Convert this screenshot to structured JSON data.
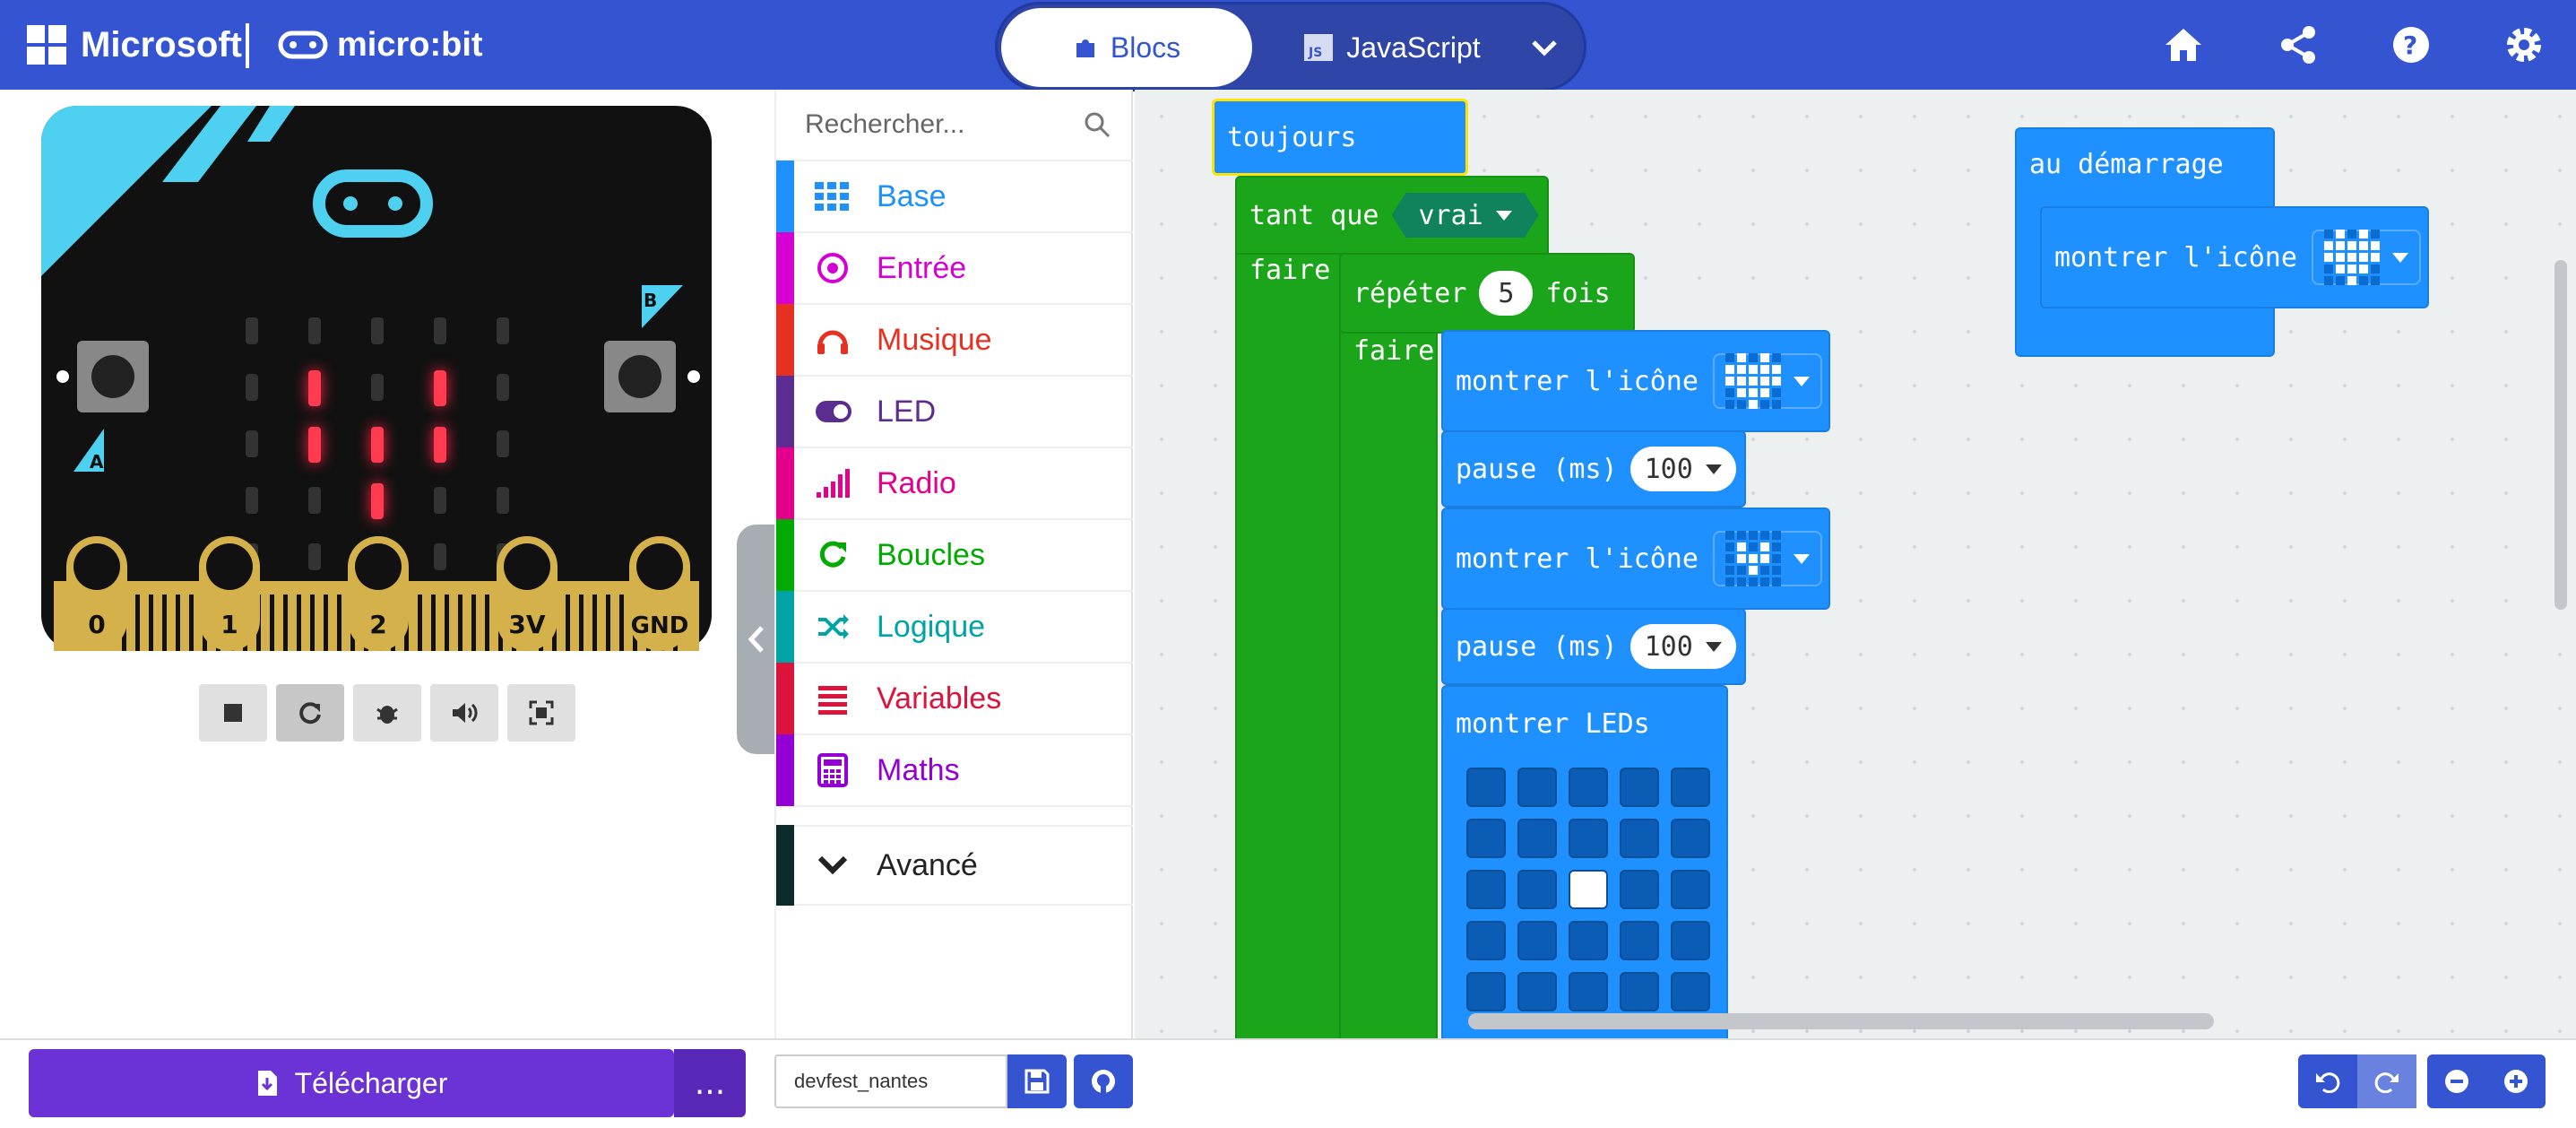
{
  "header": {
    "brand_microsoft": "Microsoft",
    "brand_microbit": "micro:bit",
    "tabs": {
      "blocks": "Blocs",
      "javascript": "JavaScript"
    },
    "icons": [
      "home-icon",
      "share-icon",
      "help-icon",
      "settings-icon"
    ]
  },
  "simulator": {
    "pins": [
      "0",
      "1",
      "2",
      "3V",
      "GND"
    ],
    "button_a": "A",
    "button_b": "B",
    "led_matrix_lit": [
      [
        0,
        1,
        0,
        1,
        0
      ],
      [
        0,
        1,
        1,
        1,
        0
      ],
      [
        0,
        0,
        1,
        0,
        0
      ]
    ],
    "toolbar_icons": [
      "stop-icon",
      "restart-icon",
      "debug-icon",
      "mute-icon",
      "fullscreen-icon"
    ]
  },
  "toolbox": {
    "search_placeholder": "Rechercher...",
    "categories": [
      {
        "label": "Base",
        "color": "#1e90ff"
      },
      {
        "label": "Entrée",
        "color": "#d400d4"
      },
      {
        "label": "Musique",
        "color": "#e63022"
      },
      {
        "label": "LED",
        "color": "#5c2d91"
      },
      {
        "label": "Radio",
        "color": "#e3008c"
      },
      {
        "label": "Boucles",
        "color": "#00aa00"
      },
      {
        "label": "Logique",
        "color": "#00a4a6"
      },
      {
        "label": "Variables",
        "color": "#dc143c"
      },
      {
        "label": "Maths",
        "color": "#9400d3"
      }
    ],
    "advanced": "Avancé"
  },
  "workspace": {
    "forever": "toujours",
    "while_label": "tant que",
    "while_value": "vrai",
    "do_label": "faire",
    "repeat_label": "répéter",
    "repeat_count": "5",
    "repeat_times": "fois",
    "repeat_do": "faire",
    "show_icon": "montrer l'icône",
    "pause_label": "pause (ms)",
    "pause_value": "100",
    "show_leds": "montrer LEDs",
    "on_start": "au démarrage",
    "on_start_show_icon": "montrer l'icône"
  },
  "footer": {
    "download": "Télécharger",
    "more": "...",
    "project_name": "devfest_nantes"
  }
}
